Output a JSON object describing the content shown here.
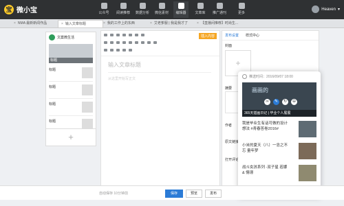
{
  "app": {
    "name": "微小宝"
  },
  "nav": [
    {
      "label": "公众号",
      "icon": "account-icon"
    },
    {
      "label": "阅读推荐",
      "icon": "chat-icon"
    },
    {
      "label": "数据分析",
      "icon": "chart-icon"
    },
    {
      "label": "微信素材",
      "icon": "material-icon"
    },
    {
      "label": "编辑器",
      "icon": "editor-icon"
    },
    {
      "label": "文章库",
      "icon": "library-icon"
    },
    {
      "label": "推广通刊",
      "icon": "promo-icon"
    },
    {
      "label": "更多",
      "icon": "more-icon"
    }
  ],
  "user": {
    "name": "Heaven"
  },
  "tabs": [
    {
      "label": "NMA 最新新闻作品"
    },
    {
      "label": "输入文章标题"
    },
    {
      "label": "我的工作上的东西"
    },
    {
      "label": "艾老爹服 | 我是我才了"
    },
    {
      "label": "【直播间推荐】时尚生..."
    }
  ],
  "left_panel": {
    "account": "文案微生活",
    "cover_title": "标题",
    "articles": [
      "标题",
      "标题",
      "标题",
      "标题"
    ]
  },
  "editor": {
    "insert_button": "插入内容",
    "title_placeholder": "输入文章标题",
    "body_placeholder": "从这里开始写正文"
  },
  "settings": {
    "tabs": [
      "发布设置",
      "样式中心"
    ],
    "cover_label": "封面",
    "summary_label": "摘要",
    "author_label": "作者",
    "original_label": "原文链接",
    "open_comment": "打开评论"
  },
  "preview": {
    "time": "推送时间：2016/09/07 18:00",
    "hero_caption": "365天插画日记 | 毕业个人展展",
    "hero_mark": "画画的",
    "items": [
      {
        "text": "我是毕业生有话可做的设计想法 #青春答卷2016#"
      },
      {
        "text": "小米的夏天（八）一念之不忘 量年梦"
      },
      {
        "text": "战斗女孩系列 -双子星 若娜 & 情璟"
      }
    ],
    "footer_icons": [
      "edit-icon",
      "send-icon",
      "share-icon",
      "delete-icon"
    ]
  },
  "bottom": {
    "autosave": "自动保存 10分钟前",
    "buttons": [
      "保存",
      "预览",
      "发布"
    ]
  }
}
